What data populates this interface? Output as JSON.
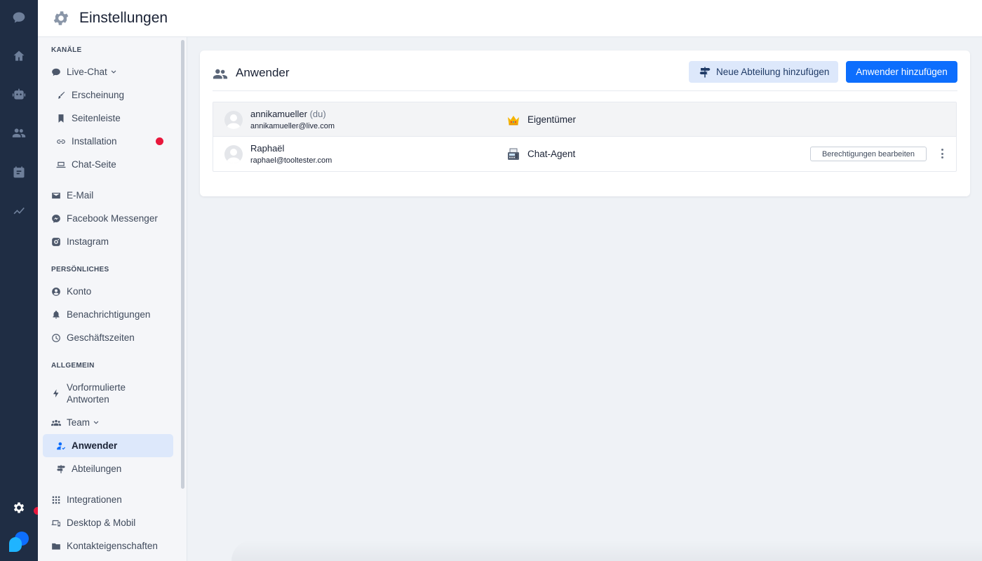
{
  "header": {
    "title": "Einstellungen"
  },
  "sidebar": {
    "sections": {
      "channels": "KANÄLE",
      "personal": "PERSÖNLICHES",
      "general": "ALLGEMEIN"
    },
    "items": {
      "live_chat": "Live-Chat",
      "appearance": "Erscheinung",
      "sidebar": "Seitenleiste",
      "installation": "Installation",
      "chat_page": "Chat-Seite",
      "email": "E-Mail",
      "facebook": "Facebook Messenger",
      "instagram": "Instagram",
      "account": "Konto",
      "notifications": "Benachrichtigungen",
      "business_hours": "Geschäftszeiten",
      "canned_line1": "Vorformulierte",
      "canned_line2": "Antworten",
      "team": "Team",
      "users": "Anwender",
      "departments": "Abteilungen",
      "integrations": "Integrationen",
      "desktop_mobile": "Desktop & Mobil",
      "contact_props": "Kontakteigenschaften"
    }
  },
  "main": {
    "title": "Anwender",
    "add_department_label": "Neue Abteilung hinzufügen",
    "add_user_label": "Anwender hinzufügen",
    "users": [
      {
        "name": "annikamueller",
        "suffix": "(du)",
        "email": "annikamueller@live.com",
        "role": "Eigentümer",
        "role_icon": "crown-icon"
      },
      {
        "name": "Raphaël",
        "suffix": "",
        "email": "raphael@tooltester.com",
        "role": "Chat-Agent",
        "role_icon": "fax-icon",
        "edit_label": "Berechtigungen bearbeiten"
      }
    ]
  },
  "colors": {
    "rail": "#1f2d44",
    "primary": "#0d6efd",
    "active_bg": "#dde8fb",
    "alert": "#e8173c"
  }
}
